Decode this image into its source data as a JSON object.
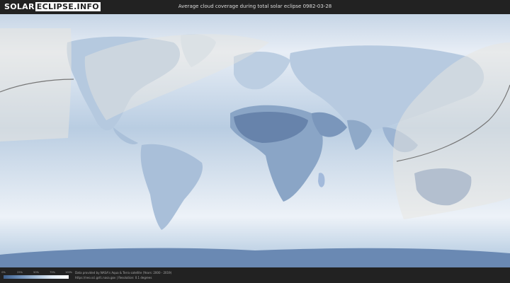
{
  "header": {
    "logo_solar": "SOLAR",
    "logo_rest": "ECLIPSE.INFO",
    "title": "Average cloud coverage during total solar eclipse 0982-03-28"
  },
  "legend": {
    "ticks": [
      "0%",
      "25%",
      "50%",
      "75%",
      "100%"
    ],
    "colors": [
      "#3d5f8c",
      "#6e8fb8",
      "#a7bfd9",
      "#e4edf6",
      "#ffffff"
    ]
  },
  "credits": {
    "line1": "Data provided by NASA's Aqua & Terra satellite (Years: 2000 - 2019)",
    "line2": "https://neo.sci.gsfc.nasa.gov | Resolution: 0.1 degrees"
  },
  "colors": {
    "ocean_cloud": "#d9e4f0",
    "land_clear": "#5f7ea6",
    "visibility_zone": "#e8e6e0",
    "eclipse_path": "#777777"
  }
}
